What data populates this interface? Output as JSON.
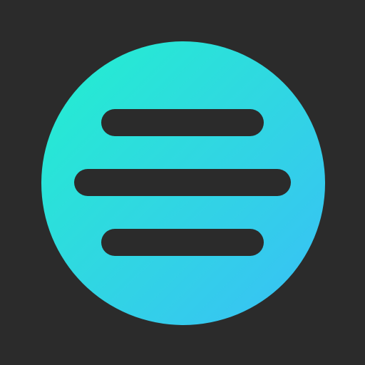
{
  "icon": {
    "name": "menu-icon",
    "background_color": "#2b2b2b",
    "circle_gradient": [
      "#22f0cf",
      "#2fd9e0",
      "#39bff7"
    ],
    "bar_color": "#2b2b2b",
    "bars": 3
  }
}
